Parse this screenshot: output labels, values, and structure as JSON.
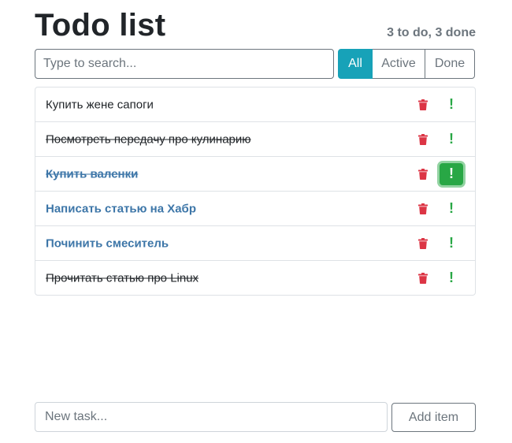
{
  "header": {
    "title": "Todo list",
    "counts": "3 to do, 3 done"
  },
  "search": {
    "placeholder": "Type to search..."
  },
  "filters": {
    "all": "All",
    "active": "Active",
    "done": "Done",
    "selected": "All"
  },
  "items": [
    {
      "label": "Купить жене сапоги",
      "done": false,
      "important": false,
      "important_pressed": false
    },
    {
      "label": "Посмотреть передачу про кулинарию",
      "done": true,
      "important": false,
      "important_pressed": false
    },
    {
      "label": "Купить валенки",
      "done": true,
      "important": true,
      "important_pressed": true
    },
    {
      "label": "Написать статью на Хабр",
      "done": false,
      "important": true,
      "important_pressed": false
    },
    {
      "label": "Починить смеситель",
      "done": false,
      "important": true,
      "important_pressed": false
    },
    {
      "label": "Прочитать статью про Linux",
      "done": true,
      "important": false,
      "important_pressed": false
    }
  ],
  "icons": {
    "delete": "trash-icon",
    "important": "exclamation-icon",
    "important_glyph": "!"
  },
  "add": {
    "placeholder": "New task...",
    "button_label": "Add item"
  },
  "colors": {
    "accent": "#17a2b8",
    "danger": "#dc3545",
    "success": "#28a745",
    "important_text": "#3d76a8",
    "muted": "#6c757d"
  }
}
